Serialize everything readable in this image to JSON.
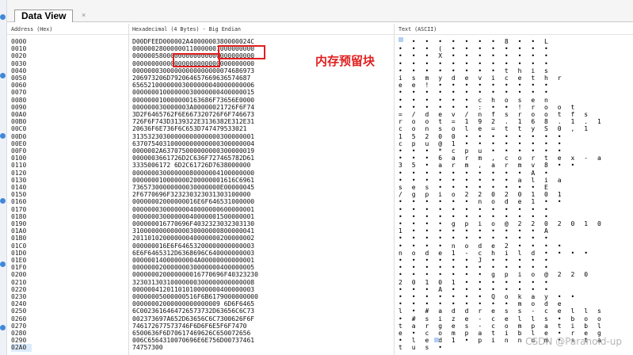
{
  "tab": {
    "title": "Data View"
  },
  "columns": {
    "address": "Address (Hex)",
    "hex": "Hexadecimal (4 Bytes) - Big Endian",
    "ascii": "Text (ASCII)"
  },
  "annotation": "内存预留块",
  "watermark": "CSDN @Paranoid-up",
  "rows": [
    {
      "addr": "0000",
      "hex": "D00DFEED000002A4000000380000024C",
      "ascii": "• • • • • • • • 8 • • L"
    },
    {
      "addr": "0010",
      "hex": "00000028000000110000001000000000",
      "ascii": "• • • ( • • • • • • • •"
    },
    {
      "addr": "0020",
      "hex": "00000058000000000000000000000000",
      "ascii": "• • • X • • • • • • • •"
    },
    {
      "addr": "0030",
      "hex": "00000000000000000000000000000000",
      "ascii": "• • • • • • • • • • • •"
    },
    {
      "addr": "0040",
      "hex": "00000003000000000000000074686973",
      "ascii": "• • • • • • • • t h i s"
    },
    {
      "addr": "0050",
      "hex": "206973206D792064657669636574687",
      "ascii": " i s   m y   d e v i c e t h r"
    },
    {
      "addr": "0060",
      "hex": "65652100000003000000040000000006",
      "ascii": "e e ! • • • • • • • • •"
    },
    {
      "addr": "0070",
      "hex": "00000001000000030000000400000015",
      "ascii": "• • • • • • • • • • • •"
    },
    {
      "addr": "0080",
      "hex": "000000010000000163686F73656E0000",
      "ascii": "• • • • • • c h o s e n"
    },
    {
      "addr": "0090",
      "hex": "000000030000003A00000021726F6F74",
      "ascii": "• • • • • • : • • ! r o o t"
    },
    {
      "addr": "00A0",
      "hex": "3D2F6465762F6E667320726F6F746673",
      "ascii": "= / d e v / n f s   r o o t f s"
    },
    {
      "addr": "00B0",
      "hex": "726F6F743D3139322E3136382E312E31",
      "ascii": "r o o t = 1 9 2 . 1 6 8 . 1 . 1"
    },
    {
      "addr": "00C0",
      "hex": "20636F6E736F6C653D747479533021",
      "ascii": "  c o n s o l e = t t y S 0 , 1"
    },
    {
      "addr": "00D0",
      "hex": "31353230300000000000000300000001",
      "ascii": "1 5 2 0 0 • • • • • • • •"
    },
    {
      "addr": "00E0",
      "hex": "63707540310000000000000300000004",
      "ascii": "c p u @ 1 • • • • • • • •"
    },
    {
      "addr": "00F0",
      "hex": "0000002A637075000000000300000019",
      "ascii": "• • • * c p u • • • • • •"
    },
    {
      "addr": "0100",
      "hex": "0000003661726D2C636F727465782D61",
      "ascii": "• • • 6 a r m , c o r t e x - a"
    },
    {
      "addr": "0110",
      "hex": "3335006172 6D2C61726D7638000000",
      "ascii": "3 5 • a r m , a r m v 8 • •"
    },
    {
      "addr": "0120",
      "hex": "00000003000000080000004100000000",
      "ascii": "• • • • • • • • • • A •"
    },
    {
      "addr": "0130",
      "hex": "000000010000000200000001616C6961",
      "ascii": "• • • • • • • • • a l i a"
    },
    {
      "addr": "0140",
      "hex": "73657300000000030000000E00000045",
      "ascii": "s e s • • • • • • • • E"
    },
    {
      "addr": "0150",
      "hex": "2F6770696F323230323031303100000",
      "ascii": "/ g p i o 2 2 0 2 0 1 0 1"
    },
    {
      "addr": "0160",
      "hex": "00000002000000016E6F646531000000",
      "ascii": "• • • • • • n o d e 1 • •"
    },
    {
      "addr": "0170",
      "hex": "00000003000000040000000600000001",
      "ascii": "• • • • • • • • • • • •"
    },
    {
      "addr": "0180",
      "hex": "00000003000000040000001500000001",
      "ascii": "• • • • • • • • • • • •"
    },
    {
      "addr": "0190",
      "hex": "000000016770696F4032323032303130",
      "ascii": "• • • • g p i o @ 2 2 0 2 0 1 0"
    },
    {
      "addr": "01A0",
      "hex": "31000000000000030000000800000041",
      "ascii": "1 • • • • • • • • • • A"
    },
    {
      "addr": "01B0",
      "hex": "20110102000000040000000200000002",
      "ascii": "• • • • • • • • • • • •"
    },
    {
      "addr": "01C0",
      "hex": "000000016E6F64653200000000000003",
      "ascii": "• • • • n o d e 2 • • • •"
    },
    {
      "addr": "01D0",
      "hex": "6E6F6465312D6368696C640000000003",
      "ascii": "n o d e 1 - c h i l d • • • •"
    },
    {
      "addr": "01E0",
      "hex": "00000014000000004A00000000000001",
      "ascii": "• • • • • • J • • • • •"
    },
    {
      "addr": "01F0",
      "hex": "00000002000000030000000400000005",
      "ascii": "• • • • • • • • • • • •"
    },
    {
      "addr": "0200",
      "hex": "000000020000000016770696F40323230",
      "ascii": "• • • • • • • g p i o @ 2 2 0"
    },
    {
      "addr": "0210",
      "hex": "32303130310000000300000000000008",
      "ascii": "2 0 1 0 1 • • • • • • •"
    },
    {
      "addr": "0220",
      "hex": "00000041201101010000000400000003",
      "ascii": "• • • A • • • • • • • •"
    },
    {
      "addr": "0230",
      "hex": "00000005000000516F6B6179000000000",
      "ascii": "• • • • • • • Q o k a y • •"
    },
    {
      "addr": "0240",
      "hex": "00000002000000000000009 6D6F6465",
      "ascii": "• • • • • • • • • m o d e"
    },
    {
      "addr": "0250",
      "hex": "6C0023616464726573732D63656C6C73",
      "ascii": "l • # a d d r e s s - c e l l s"
    },
    {
      "addr": "0260",
      "hex": "002373697A652D63656C6C7300626F6F",
      "ascii": "• # s i z e - c e l l s • b o o"
    },
    {
      "addr": "0270",
      "hex": "746172677573746F6D6F6E5F6F7470",
      "ascii": "t a r g e s - c o m p a t i b l"
    },
    {
      "addr": "0280",
      "hex": "6500636F6D70617469626C650072656",
      "ascii": "e • c o m p a t i b l e • r e g"
    },
    {
      "addr": "0290",
      "hex": "006C6564310070696E6E756D00737461",
      "ascii": "• l e d 1 • p i n n u m • s t a"
    },
    {
      "addr": "02A0",
      "hex": "74757300",
      "ascii": "t u s •"
    }
  ]
}
